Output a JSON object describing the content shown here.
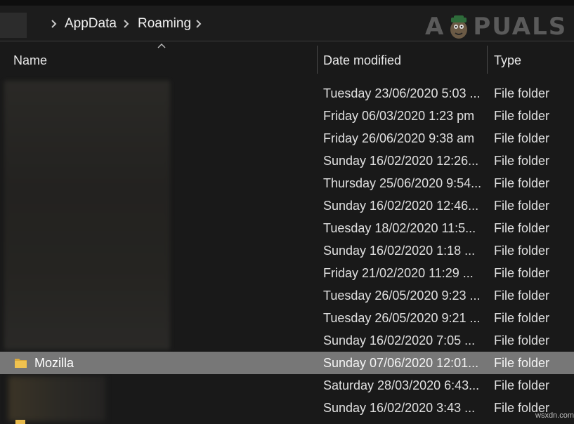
{
  "breadcrumb": [
    "AppData",
    "Roaming"
  ],
  "watermark": {
    "prefix": "A",
    "suffix": "PUALS"
  },
  "columns": {
    "name": "Name",
    "date": "Date modified",
    "type": "Type"
  },
  "rows": [
    {
      "name": "",
      "date": "Tuesday 23/06/2020 5:03 ...",
      "type": "File folder"
    },
    {
      "name": "",
      "date": "Friday 06/03/2020 1:23 pm",
      "type": "File folder"
    },
    {
      "name": "",
      "date": "Friday 26/06/2020 9:38 am",
      "type": "File folder"
    },
    {
      "name": "",
      "date": "Sunday 16/02/2020 12:26...",
      "type": "File folder"
    },
    {
      "name": "",
      "date": "Thursday 25/06/2020 9:54...",
      "type": "File folder"
    },
    {
      "name": "",
      "date": "Sunday 16/02/2020 12:46...",
      "type": "File folder"
    },
    {
      "name": "",
      "date": "Tuesday 18/02/2020 11:5...",
      "type": "File folder"
    },
    {
      "name": "",
      "date": "Sunday 16/02/2020 1:18 ...",
      "type": "File folder"
    },
    {
      "name": "",
      "date": "Friday 21/02/2020 11:29 ...",
      "type": "File folder"
    },
    {
      "name": "",
      "date": "Tuesday 26/05/2020 9:23 ...",
      "type": "File folder"
    },
    {
      "name": "",
      "date": "Tuesday 26/05/2020 9:21 ...",
      "type": "File folder"
    },
    {
      "name": "",
      "date": "Sunday 16/02/2020 7:05 ...",
      "type": "File folder"
    },
    {
      "name": "Mozilla",
      "date": "Sunday 07/06/2020 12:01...",
      "type": "File folder",
      "selected": true
    },
    {
      "name": "",
      "date": "Saturday 28/03/2020 6:43...",
      "type": "File folder"
    },
    {
      "name": "",
      "date": "Sunday 16/02/2020 3:43 ...",
      "type": "File folder"
    }
  ],
  "footer": "wsxdn.com",
  "colors": {
    "background": "#191919",
    "selected_row": "#777777",
    "folder": "#e6b84a"
  }
}
